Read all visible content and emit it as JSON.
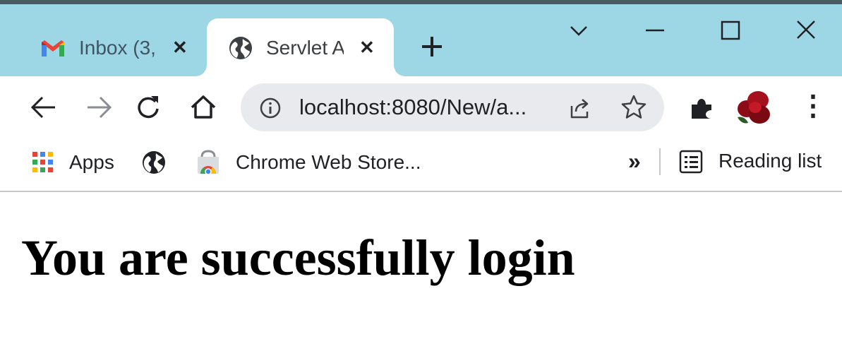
{
  "tabs": [
    {
      "title": "Inbox (3,",
      "icon": "gmail-icon",
      "active": false
    },
    {
      "title": "Servlet A",
      "icon": "globe-icon",
      "active": true
    }
  ],
  "tab_close_glyph": "✕",
  "new_tab_glyph": "+",
  "toolbar": {
    "url": "localhost:8080/New/a...",
    "menu_glyph": "⋮"
  },
  "bookmarks": {
    "apps_label": "Apps",
    "store_label": "Chrome Web Store...",
    "overflow_glyph": "»",
    "reading_list_label": "Reading list"
  },
  "page": {
    "heading": "You are successfully login"
  },
  "colors": {
    "tab_strip": "#9dd7e6",
    "omnibox": "#e9eaed",
    "text": "#202124"
  }
}
